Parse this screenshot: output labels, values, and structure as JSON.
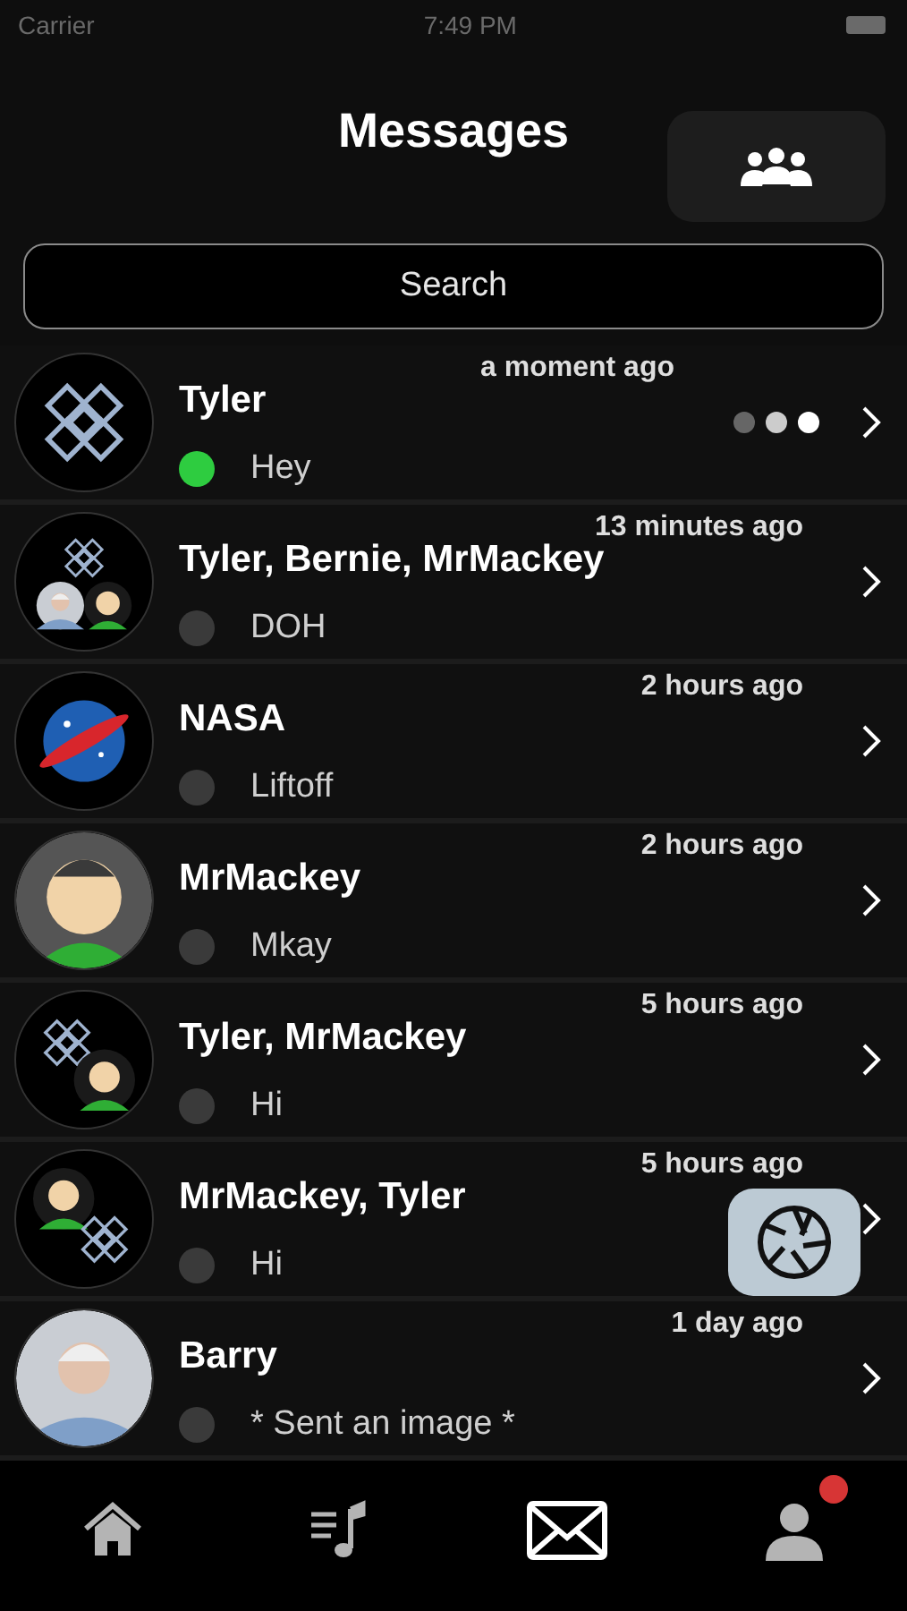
{
  "status_bar": {
    "carrier": "Carrier",
    "time": "7:49 PM"
  },
  "header": {
    "title": "Messages"
  },
  "search": {
    "placeholder": "Search"
  },
  "conversations": [
    {
      "name": "Tyler",
      "preview": "Hey",
      "time": "a moment ago",
      "online": true,
      "typing": true
    },
    {
      "name": "Tyler, Bernie, MrMackey",
      "preview": "DOH",
      "time": "13 minutes ago",
      "online": false,
      "typing": false
    },
    {
      "name": "NASA",
      "preview": "Liftoff",
      "time": "2 hours ago",
      "online": false,
      "typing": false
    },
    {
      "name": "MrMackey",
      "preview": "Mkay",
      "time": "2 hours ago",
      "online": false,
      "typing": false
    },
    {
      "name": "Tyler, MrMackey",
      "preview": "Hi",
      "time": "5 hours ago",
      "online": false,
      "typing": false
    },
    {
      "name": "MrMackey, Tyler",
      "preview": "Hi",
      "time": "5 hours ago",
      "online": false,
      "typing": false
    },
    {
      "name": "Barry",
      "preview": "* Sent an image *",
      "time": "1 day ago",
      "online": false,
      "typing": false
    }
  ],
  "tab_bar": [
    {
      "kind": "home",
      "selected": false,
      "badge": false
    },
    {
      "kind": "music",
      "selected": false,
      "badge": false
    },
    {
      "kind": "mail",
      "selected": true,
      "badge": false
    },
    {
      "kind": "profile",
      "selected": false,
      "badge": true
    }
  ]
}
